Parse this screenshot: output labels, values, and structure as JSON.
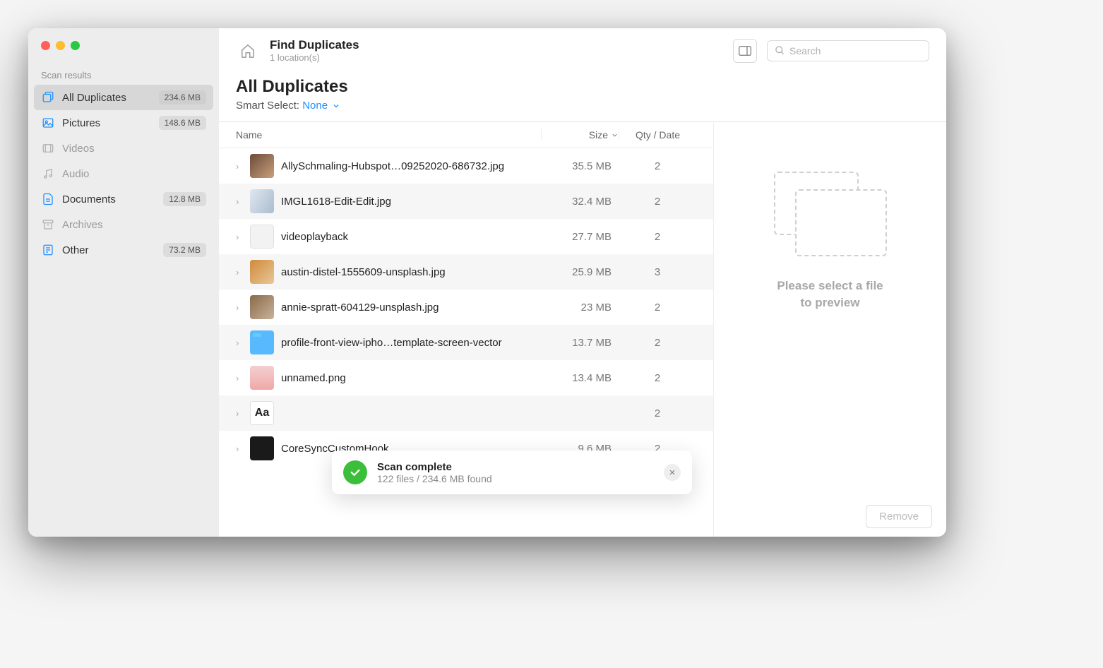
{
  "sidebar": {
    "section_label": "Scan results",
    "items": [
      {
        "label": "All Duplicates",
        "badge": "234.6 MB",
        "active": true,
        "muted": false,
        "icon": "stack"
      },
      {
        "label": "Pictures",
        "badge": "148.6 MB",
        "active": false,
        "muted": false,
        "icon": "picture"
      },
      {
        "label": "Videos",
        "badge": "",
        "active": false,
        "muted": true,
        "icon": "video"
      },
      {
        "label": "Audio",
        "badge": "",
        "active": false,
        "muted": true,
        "icon": "audio"
      },
      {
        "label": "Documents",
        "badge": "12.8 MB",
        "active": false,
        "muted": false,
        "icon": "document"
      },
      {
        "label": "Archives",
        "badge": "",
        "active": false,
        "muted": true,
        "icon": "archive"
      },
      {
        "label": "Other",
        "badge": "73.2 MB",
        "active": false,
        "muted": false,
        "icon": "other"
      }
    ]
  },
  "header": {
    "title": "Find Duplicates",
    "subtitle": "1 location(s)",
    "search_placeholder": "Search"
  },
  "page": {
    "heading": "All Duplicates",
    "smart_select_label": "Smart Select:",
    "smart_select_value": "None"
  },
  "table": {
    "columns": {
      "name": "Name",
      "size": "Size",
      "qty": "Qty / Date"
    },
    "rows": [
      {
        "thumb": "img1",
        "name": "AllySchmaling-Hubspot…09252020-686732.jpg",
        "size": "35.5 MB",
        "qty": "2"
      },
      {
        "thumb": "img2",
        "name": "IMGL1618-Edit-Edit.jpg",
        "size": "32.4 MB",
        "qty": "2"
      },
      {
        "thumb": "doc",
        "name": "videoplayback",
        "size": "27.7 MB",
        "qty": "2"
      },
      {
        "thumb": "img3",
        "name": "austin-distel-1555609-unsplash.jpg",
        "size": "25.9 MB",
        "qty": "3"
      },
      {
        "thumb": "img4",
        "name": "annie-spratt-604129-unsplash.jpg",
        "size": "23 MB",
        "qty": "2"
      },
      {
        "thumb": "folder",
        "name": "profile-front-view-ipho…template-screen-vector",
        "size": "13.7 MB",
        "qty": "2"
      },
      {
        "thumb": "img5",
        "name": "unnamed.png",
        "size": "13.4 MB",
        "qty": "2"
      },
      {
        "thumb": "aa",
        "name": "",
        "size": "",
        "qty": "2",
        "aa": "Aa"
      },
      {
        "thumb": "dark",
        "name": "CoreSyncCustomHook",
        "size": "9.6 MB",
        "qty": "2"
      }
    ]
  },
  "preview": {
    "text1": "Please select a file",
    "text2": "to preview"
  },
  "footer": {
    "remove": "Remove"
  },
  "toast": {
    "title": "Scan complete",
    "subtitle": "122 files / 234.6 MB found"
  }
}
